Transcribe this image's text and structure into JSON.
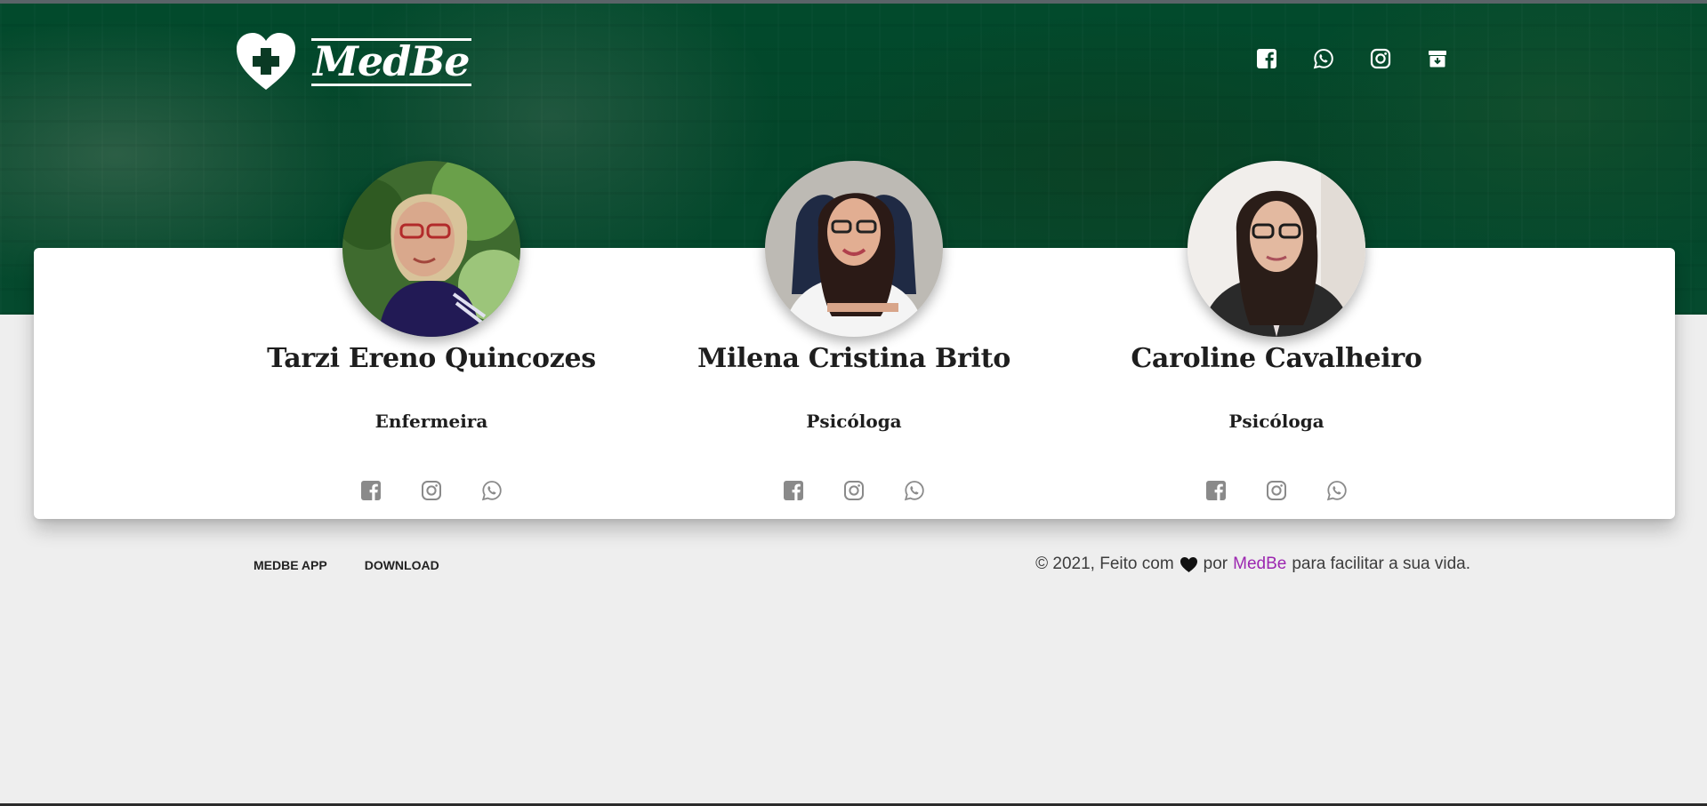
{
  "header": {
    "brand_name": "MedBe",
    "social": [
      {
        "icon": "facebook-square-icon"
      },
      {
        "icon": "whatsapp-icon"
      },
      {
        "icon": "instagram-icon"
      },
      {
        "icon": "archive-icon"
      }
    ]
  },
  "team": [
    {
      "name": "Tarzi Ereno Quincozes",
      "role": "Enfermeira"
    },
    {
      "name": "Milena Cristina Brito",
      "role": "Psicóloga"
    },
    {
      "name": "Caroline Cavalheiro",
      "role": "Psicóloga"
    }
  ],
  "footer": {
    "links": [
      "MEDBE APP",
      "DOWNLOAD"
    ],
    "copyright_prefix": "© 2021, Feito com",
    "copyright_by": "por",
    "copyright_brand": "MedBe",
    "copyright_suffix": "para facilitar a sua vida."
  },
  "colors": {
    "header_green": "#03462a",
    "page_background": "#eeeeee",
    "brand_link": "#9c27b0",
    "icon_gray": "#8a8a8a"
  }
}
